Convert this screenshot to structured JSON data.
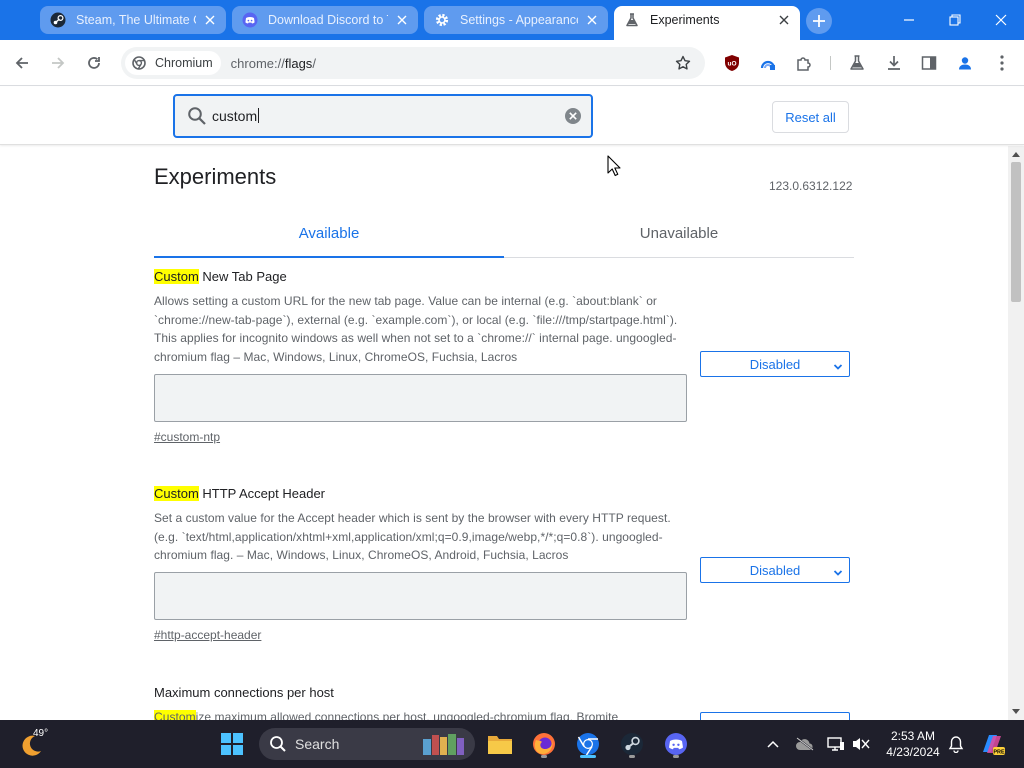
{
  "browser": {
    "tabs": [
      {
        "title": "Steam, The Ultimate O",
        "favicon": "steam-icon",
        "state": "background"
      },
      {
        "title": "Download Discord to T",
        "favicon": "discord-icon",
        "state": "background"
      },
      {
        "title": "Settings - Appearance",
        "favicon": "gear-icon",
        "state": "background"
      },
      {
        "title": "Experiments",
        "favicon": "flask-icon",
        "state": "active"
      }
    ],
    "chip_label": "Chromium",
    "url_prefix": "chrome://",
    "url_host": "flags",
    "url_suffix": "/",
    "accent_color": "#1a73e8"
  },
  "flags_header": {
    "search_value": "custom",
    "reset_label": "Reset all"
  },
  "page": {
    "title": "Experiments",
    "version": "123.0.6312.122",
    "tabs": {
      "available": "Available",
      "unavailable": "Unavailable"
    },
    "experiments": [
      {
        "match": "Custom",
        "name_rest": " New Tab Page",
        "description": "Allows setting a custom URL for the new tab page. Value can be internal (e.g. `about:blank` or `chrome://new-tab-page`), external (e.g. `example.com`), or local (e.g. `file:///tmp/startpage.html`). This applies for incognito windows as well when not set to a `chrome://` internal page. ungoogled-chromium flag – Mac, Windows, Linux, ChromeOS, Fuchsia, Lacros",
        "permalink": "#custom-ntp",
        "select_value": "Disabled"
      },
      {
        "match": "Custom",
        "name_rest": " HTTP Accept Header",
        "description": "Set a custom value for the Accept header which is sent by the browser with every HTTP request. (e.g. `text/html,application/xhtml+xml,application/xml;q=0.9,image/webp,*/*;q=0.8`). ungoogled-chromium flag. – Mac, Windows, Linux, ChromeOS, Android, Fuchsia, Lacros",
        "permalink": "#http-accept-header",
        "select_value": "Disabled"
      },
      {
        "name": "Maximum connections per host",
        "desc_match": "Custom",
        "desc_rest": "ize maximum allowed connections per host. ungoogled-chromium flag, Bromite"
      }
    ]
  },
  "taskbar": {
    "weather_temp": "49°",
    "search_label": "Search",
    "time": "2:53 AM",
    "date": "4/23/2024",
    "accent_color": "#4cc2ff"
  }
}
